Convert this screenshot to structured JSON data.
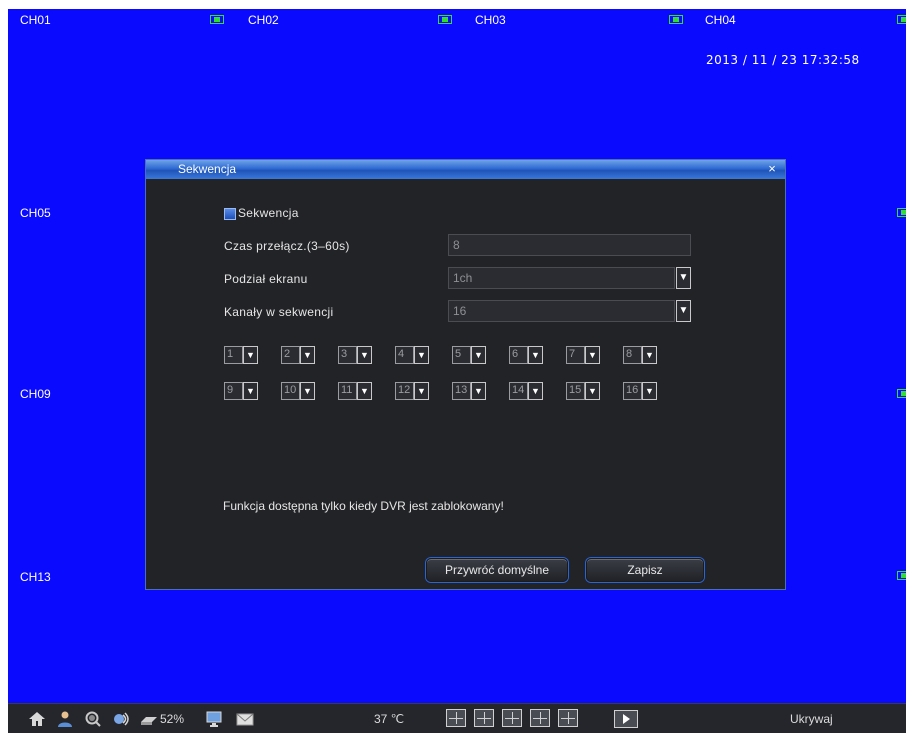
{
  "channels": {
    "ch01": "CH01",
    "ch02": "CH02",
    "ch03": "CH03",
    "ch04": "CH04",
    "ch05": "CH05",
    "ch09": "CH09",
    "ch13": "CH13"
  },
  "datetime": "2013 / 11 / 23 17:32:58",
  "dialog": {
    "title": "Sekwencja",
    "close_glyph": "×",
    "enable_label": "Sekwencja",
    "dwell_label": "Czas przełącz.(3–60s)",
    "dwell_value": "8",
    "split_label": "Podział ekranu",
    "split_value": "1ch",
    "count_label": "Kanały w sekwencji",
    "count_value": "16",
    "sequence_slots": [
      "1",
      "2",
      "3",
      "4",
      "5",
      "6",
      "7",
      "8",
      "9",
      "10",
      "11",
      "12",
      "13",
      "14",
      "15",
      "16"
    ],
    "warning": "Funkcja dostępna tylko kiedy DVR jest zablokowany!",
    "restore_label": "Przywróć domyślne",
    "save_label": "Zapisz"
  },
  "taskbar": {
    "hdd_percent": "52%",
    "temperature": "37 ℃",
    "hide_label": "Ukrywaj"
  },
  "colors": {
    "screen_bg": "#0a0aff",
    "dialog_bg": "#222327",
    "titlebar": "#2e6ad2",
    "rec_indicator": "#33dd33"
  }
}
